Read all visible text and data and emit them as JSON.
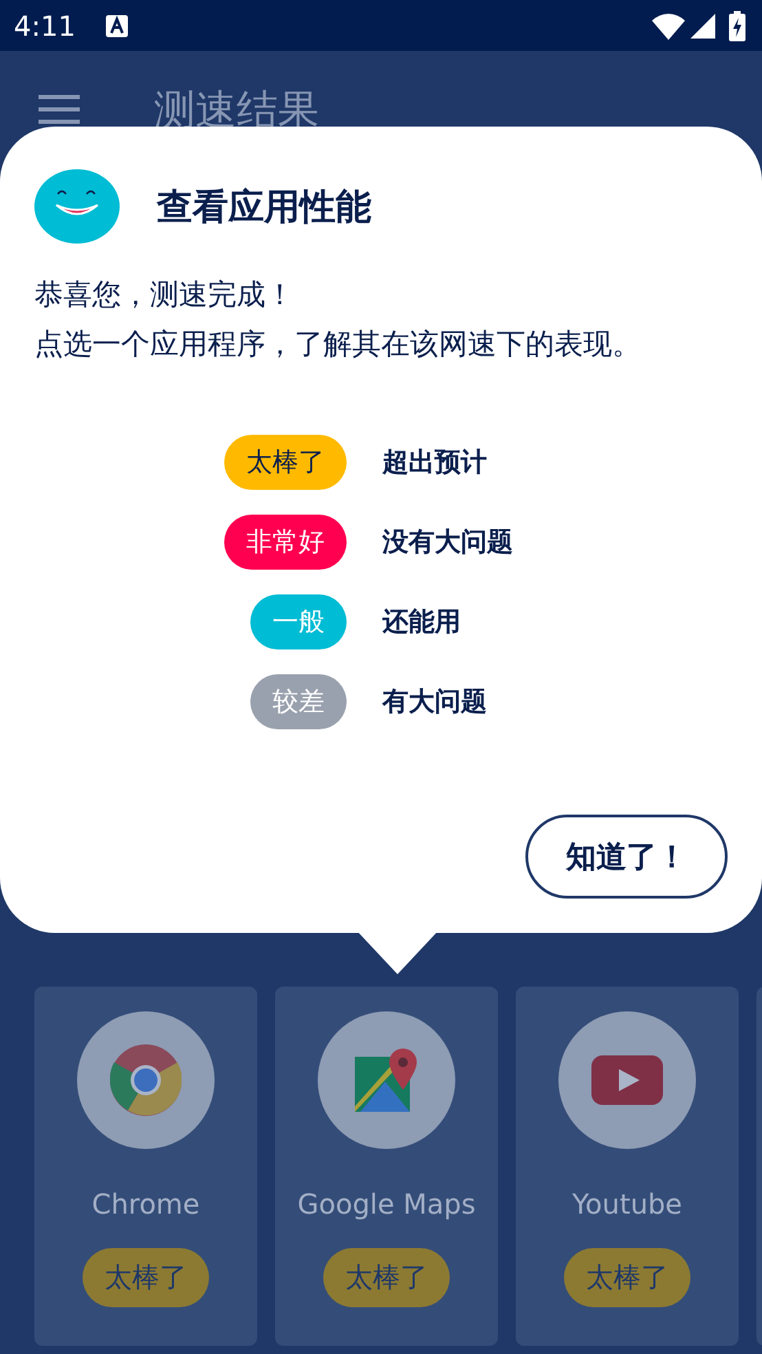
{
  "status_bar": {
    "time": "4:11"
  },
  "app_bar": {
    "title": "测速结果"
  },
  "popup": {
    "title": "查看应用性能",
    "message": [
      "恭喜您，测速完成！",
      "点选一个应用程序，了解其在该网速下的表现。"
    ],
    "legend": [
      {
        "label": "太棒了",
        "description": "超出预计",
        "color": "#ffba00"
      },
      {
        "label": "非常好",
        "description": "没有大问题",
        "color": "#ff0050"
      },
      {
        "label": "一般",
        "description": "还能用",
        "color": "#00bcd4"
      },
      {
        "label": "较差",
        "description": "有大问题",
        "color": "#9aa1ae"
      }
    ],
    "button": "知道了！"
  },
  "apps": [
    {
      "name": "Chrome",
      "kind": "chrome",
      "rating": "太棒了"
    },
    {
      "name": "Google Maps",
      "kind": "maps",
      "rating": "太棒了"
    },
    {
      "name": "Youtube",
      "kind": "youtube",
      "rating": "太棒了"
    }
  ]
}
